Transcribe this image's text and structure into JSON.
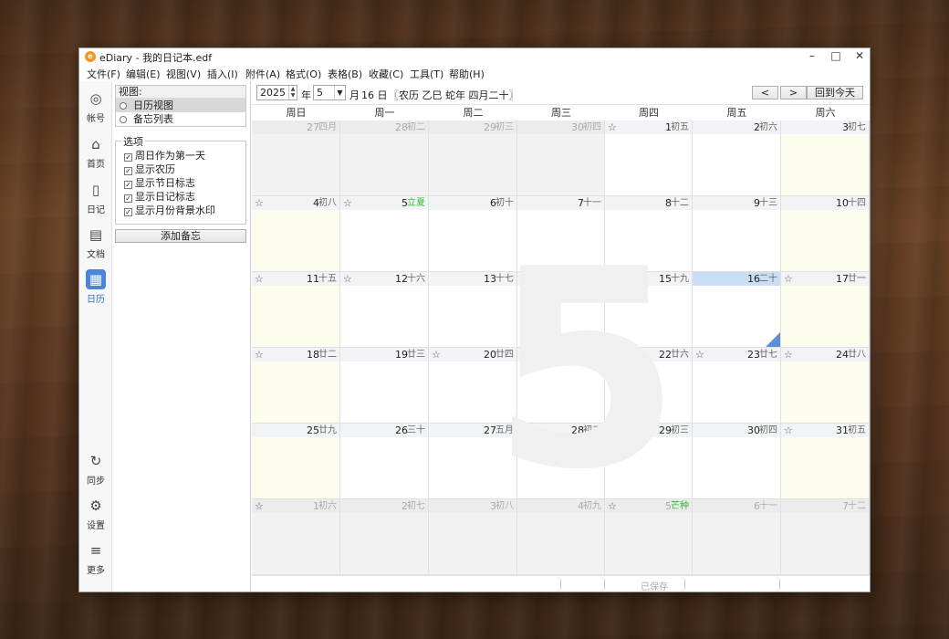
{
  "window": {
    "title": "eDiary - 我的日记本.edf",
    "icon_letter": "e"
  },
  "menu": [
    "文件(F)",
    "编辑(E)",
    "视图(V)",
    "插入(I)",
    "附件(A)",
    "格式(O)",
    "表格(B)",
    "收藏(C)",
    "工具(T)",
    "帮助(H)"
  ],
  "nav": {
    "top": [
      {
        "icon": "user-circle-icon",
        "glyph": "◎",
        "label": "帐号"
      },
      {
        "icon": "home-icon",
        "glyph": "⌂",
        "label": "首页"
      },
      {
        "icon": "notebook-icon",
        "glyph": "▯",
        "label": "日记"
      },
      {
        "icon": "document-icon",
        "glyph": "▤",
        "label": "文档"
      },
      {
        "icon": "calendar-icon",
        "glyph": "▦",
        "label": "日历",
        "active": true
      }
    ],
    "bottom": [
      {
        "icon": "sync-icon",
        "glyph": "↻",
        "label": "同步"
      },
      {
        "icon": "settings-icon",
        "glyph": "⚙",
        "label": "设置"
      },
      {
        "icon": "more-icon",
        "glyph": "≡",
        "label": "更多"
      }
    ]
  },
  "side": {
    "view_title": "视图:",
    "views": [
      "日历视图",
      "备忘列表"
    ],
    "selected_view": "日历视图",
    "options_title": "选项",
    "options": [
      {
        "label": "周日作为第一天",
        "checked": true
      },
      {
        "label": "显示农历",
        "checked": true
      },
      {
        "label": "显示节日标志",
        "checked": true
      },
      {
        "label": "显示日记标志",
        "checked": true
      },
      {
        "label": "显示月份背景水印",
        "checked": true
      }
    ],
    "add_button": "添加备忘"
  },
  "toolbar": {
    "year": "2025",
    "year_suffix": "年",
    "month": "5",
    "month_suffix": "月",
    "day_text": "16 日",
    "lunar_text": "〖农历 乙巳 蛇年 四月二十〗",
    "prev": "<",
    "next": ">",
    "today_button": "回到今天"
  },
  "calendar": {
    "weekdays": [
      "周日",
      "周一",
      "周二",
      "周三",
      "周四",
      "周五",
      "周六"
    ],
    "watermark": "5",
    "weeks": [
      [
        {
          "day": "27",
          "lunar": "四月",
          "out": true,
          "star": false
        },
        {
          "day": "28",
          "lunar": "初二",
          "out": true,
          "star": false
        },
        {
          "day": "29",
          "lunar": "初三",
          "out": true,
          "star": false
        },
        {
          "day": "30",
          "lunar": "初四",
          "out": true,
          "star": false
        },
        {
          "day": "1",
          "lunar": "初五",
          "star": true
        },
        {
          "day": "2",
          "lunar": "初六",
          "star": false
        },
        {
          "day": "3",
          "lunar": "初七",
          "star": false,
          "weekend": true
        }
      ],
      [
        {
          "day": "4",
          "lunar": "初八",
          "star": true,
          "weekend": true
        },
        {
          "day": "5",
          "lunar": "立夏",
          "term": true,
          "star": true
        },
        {
          "day": "6",
          "lunar": "初十",
          "star": false
        },
        {
          "day": "7",
          "lunar": "十一",
          "star": false
        },
        {
          "day": "8",
          "lunar": "十二",
          "star": false
        },
        {
          "day": "9",
          "lunar": "十三",
          "star": false
        },
        {
          "day": "10",
          "lunar": "十四",
          "star": false,
          "weekend": true
        }
      ],
      [
        {
          "day": "11",
          "lunar": "十五",
          "star": true,
          "weekend": true
        },
        {
          "day": "12",
          "lunar": "十六",
          "star": true
        },
        {
          "day": "13",
          "lunar": "十七",
          "star": false
        },
        {
          "day": "14",
          "lunar": "十八",
          "star": false
        },
        {
          "day": "15",
          "lunar": "十九",
          "star": false
        },
        {
          "day": "16",
          "lunar": "二十",
          "today": true,
          "star": false
        },
        {
          "day": "17",
          "lunar": "廿一",
          "star": true,
          "weekend": true
        }
      ],
      [
        {
          "day": "18",
          "lunar": "廿二",
          "star": true,
          "weekend": true
        },
        {
          "day": "19",
          "lunar": "廿三",
          "star": false
        },
        {
          "day": "20",
          "lunar": "廿四",
          "star": true
        },
        {
          "day": "21",
          "lunar": "小满",
          "term": true,
          "star": false
        },
        {
          "day": "22",
          "lunar": "廿六",
          "star": false
        },
        {
          "day": "23",
          "lunar": "廿七",
          "star": true
        },
        {
          "day": "24",
          "lunar": "廿八",
          "star": true,
          "weekend": true
        }
      ],
      [
        {
          "day": "25",
          "lunar": "廿九",
          "star": false,
          "weekend": true
        },
        {
          "day": "26",
          "lunar": "三十",
          "star": false
        },
        {
          "day": "27",
          "lunar": "五月",
          "star": false
        },
        {
          "day": "28",
          "lunar": "初二",
          "star": false
        },
        {
          "day": "29",
          "lunar": "初三",
          "star": false
        },
        {
          "day": "30",
          "lunar": "初四",
          "star": false
        },
        {
          "day": "31",
          "lunar": "初五",
          "star": true,
          "weekend": true
        }
      ],
      [
        {
          "day": "1",
          "lunar": "初六",
          "out": true,
          "star": true
        },
        {
          "day": "2",
          "lunar": "初七",
          "out": true,
          "star": false
        },
        {
          "day": "3",
          "lunar": "初八",
          "out": true,
          "star": false
        },
        {
          "day": "4",
          "lunar": "初九",
          "out": true,
          "star": false
        },
        {
          "day": "5",
          "lunar": "芒种",
          "term": true,
          "out": true,
          "star": true
        },
        {
          "day": "6",
          "lunar": "十一",
          "out": true,
          "star": false
        },
        {
          "day": "7",
          "lunar": "十二",
          "out": true,
          "star": false
        }
      ]
    ]
  },
  "status": {
    "saved": "已保存"
  },
  "colors": {
    "weekend_bg": "#fcfdec",
    "out_bg": "#f2f2f2",
    "normal_bg": "#ffffff",
    "accent": "#4a86d8",
    "solar_term": "#35b735"
  }
}
